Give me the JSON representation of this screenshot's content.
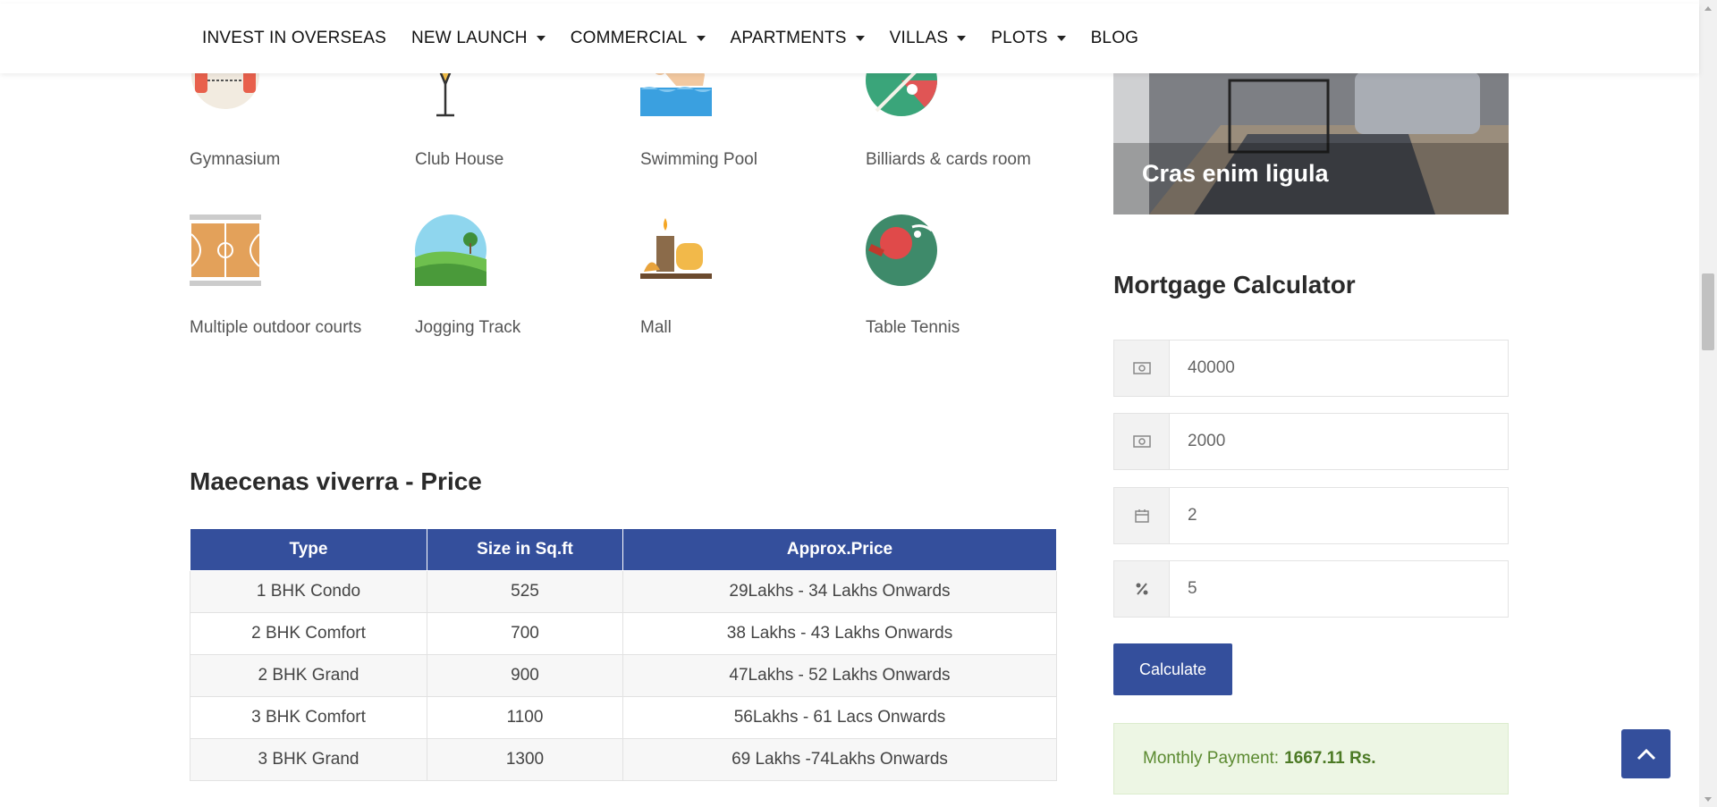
{
  "nav": {
    "items": [
      {
        "label": "INVEST IN OVERSEAS",
        "dropdown": false
      },
      {
        "label": "NEW LAUNCH",
        "dropdown": true
      },
      {
        "label": "COMMERCIAL",
        "dropdown": true
      },
      {
        "label": "APARTMENTS",
        "dropdown": true
      },
      {
        "label": "VILLAS",
        "dropdown": true
      },
      {
        "label": "PLOTS",
        "dropdown": true
      },
      {
        "label": "BLOG",
        "dropdown": false
      }
    ]
  },
  "amenities": [
    {
      "label": "Gymnasium",
      "icon": "gym-icon"
    },
    {
      "label": "Club House",
      "icon": "cocktail-glass-icon"
    },
    {
      "label": "Swimming Pool",
      "icon": "swimmer-icon"
    },
    {
      "label": "Billiards & cards room",
      "icon": "billiards-icon"
    },
    {
      "label": "Multiple outdoor courts",
      "icon": "basketball-court-icon"
    },
    {
      "label": "Jogging Track",
      "icon": "landscape-icon"
    },
    {
      "label": "Mall",
      "icon": "spa-stones-icon"
    },
    {
      "label": "Table Tennis",
      "icon": "table-tennis-icon"
    }
  ],
  "price": {
    "title": "Maecenas viverra - Price",
    "headers": [
      "Type",
      "Size in Sq.ft",
      "Approx.Price"
    ],
    "rows": [
      [
        "1 BHK Condo",
        "525",
        "29Lakhs - 34 Lakhs Onwards"
      ],
      [
        "2 BHK Comfort",
        "700",
        "38 Lakhs - 43 Lakhs Onwards"
      ],
      [
        "2 BHK Grand",
        "900",
        "47Lakhs - 52 Lakhs Onwards"
      ],
      [
        "3 BHK Comfort",
        "1100",
        "56Lakhs - 61 Lacs Onwards"
      ],
      [
        "3 BHK Grand",
        "1300",
        "69 Lakhs -74Lakhs Onwards"
      ]
    ]
  },
  "hero": {
    "label": "Cras enim ligula"
  },
  "mortgage": {
    "title": "Mortgage Calculator",
    "fields": [
      {
        "value": "40000",
        "icon": "money-icon"
      },
      {
        "value": "2000",
        "icon": "money-icon"
      },
      {
        "value": "2",
        "icon": "calendar-icon"
      },
      {
        "value": "5",
        "icon": "percent-icon"
      }
    ],
    "calculate_label": "Calculate",
    "result_label": "Monthly Payment:",
    "result_value": "1667.11 Rs."
  },
  "colors": {
    "primary": "#344f9c",
    "success_bg": "#edf6e4",
    "success_text": "#5b8a30"
  }
}
